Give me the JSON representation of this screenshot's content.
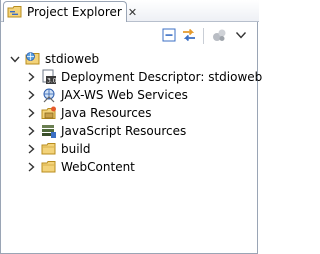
{
  "view": {
    "title": "Project Explorer",
    "close_symbol": "✕"
  },
  "toolbar": {
    "buttons": [
      {
        "name": "collapse-all-icon"
      },
      {
        "name": "link-with-editor-icon"
      },
      {
        "name": "focus-on-working-set-icon"
      },
      {
        "name": "view-menu-chevron-icon"
      }
    ]
  },
  "tree": {
    "project": {
      "label": "stdioweb",
      "icon": "web-project-icon",
      "expanded": true
    },
    "children": [
      {
        "label": "Deployment Descriptor: stdioweb",
        "icon": "deployment-descriptor-icon"
      },
      {
        "label": "JAX-WS Web Services",
        "icon": "web-services-icon"
      },
      {
        "label": "Java Resources",
        "icon": "java-resources-icon"
      },
      {
        "label": "JavaScript Resources",
        "icon": "javascript-resources-icon"
      },
      {
        "label": "build",
        "icon": "folder-icon"
      },
      {
        "label": "WebContent",
        "icon": "folder-icon"
      }
    ]
  },
  "colors": {
    "folder": "#e8c45a",
    "folder_border": "#b88d1e",
    "accent_blue": "#2f5fb0",
    "toolbar_blue": "#3b6fc4",
    "toolbar_orange": "#e59a2b"
  }
}
